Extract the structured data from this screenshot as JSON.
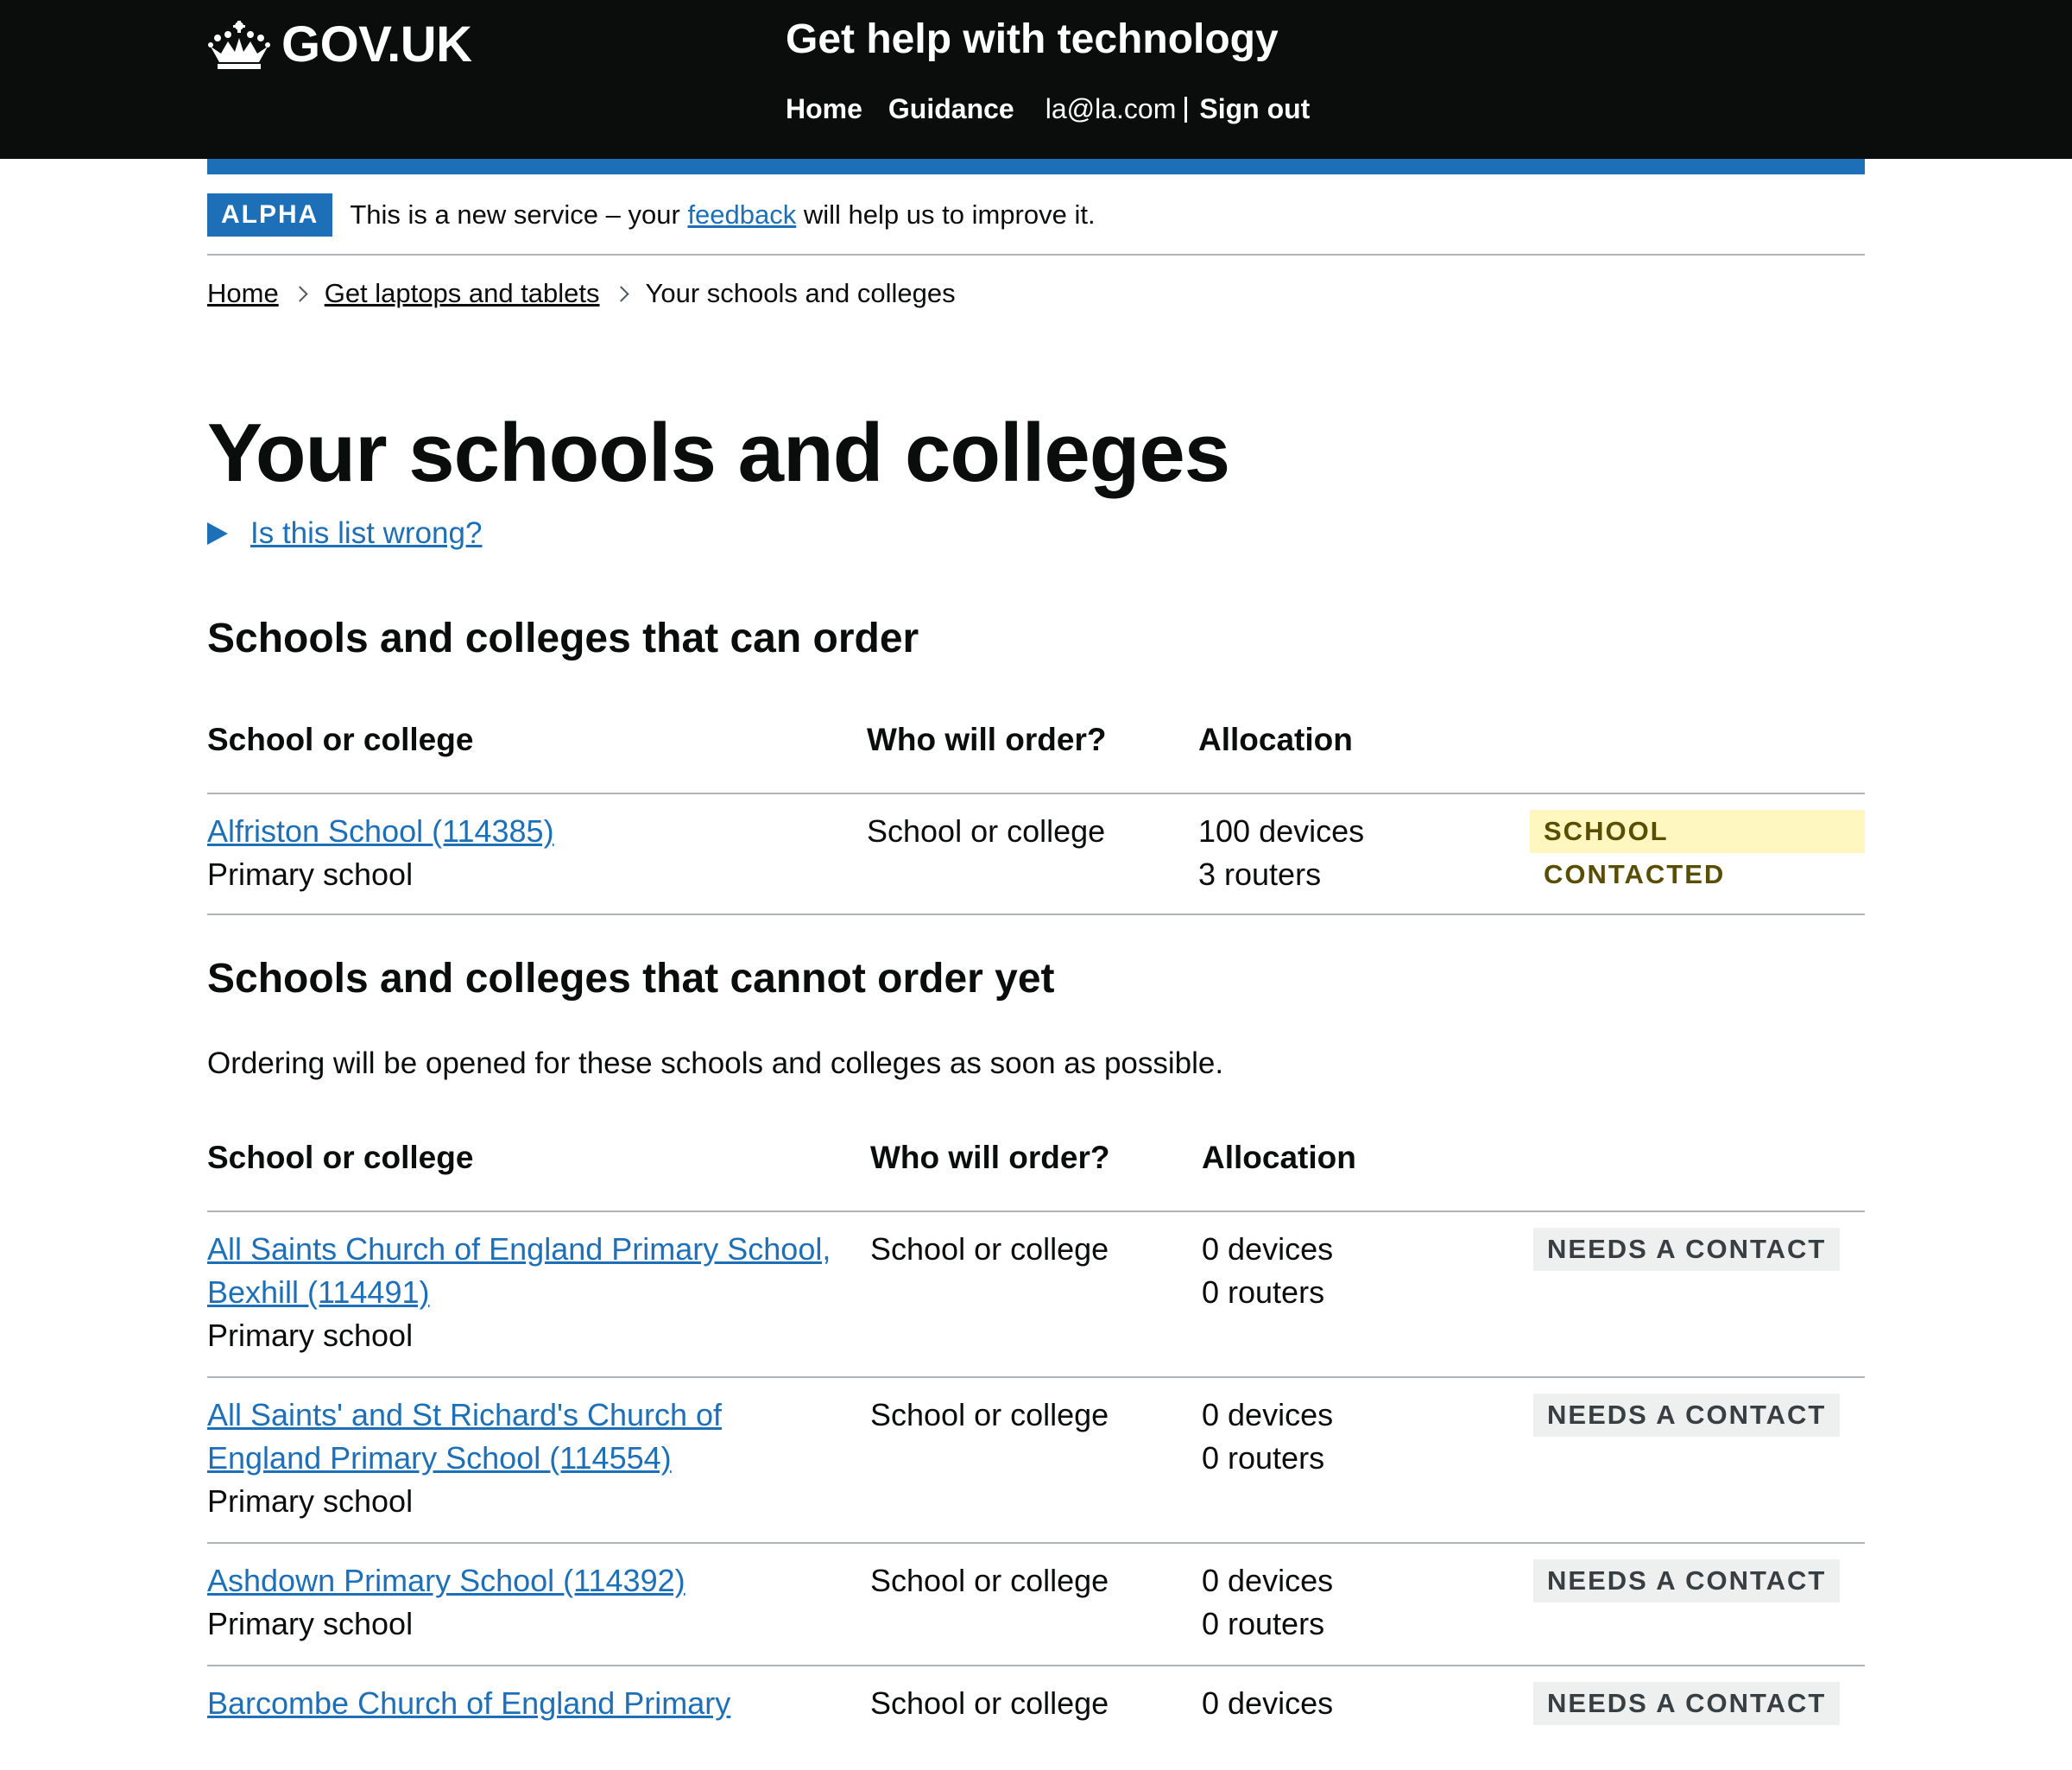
{
  "header": {
    "logo_text": "GOV.UK",
    "service_name": "Get help with technology",
    "nav": {
      "home": "Home",
      "guidance": "Guidance",
      "user_email": "la@la.com",
      "sign_out": "Sign out"
    }
  },
  "phase_banner": {
    "tag": "ALPHA",
    "text_before": "This is a new service – your ",
    "link": "feedback",
    "text_after": " will help us to improve it."
  },
  "breadcrumbs": [
    "Home",
    "Get laptops and tablets",
    "Your schools and colleges"
  ],
  "page_title": "Your schools and colleges",
  "details_summary": "Is this list wrong?",
  "can_order": {
    "heading": "Schools and colleges that can order",
    "columns": [
      "School or college",
      "Who will order?",
      "Allocation",
      ""
    ],
    "rows": [
      {
        "name": "Alfriston School (114385)",
        "type": "Primary school",
        "who": "School or college",
        "devices": "100 devices",
        "routers": "3 routers",
        "status": "SCHOOL CONTACTED"
      }
    ]
  },
  "cannot_order": {
    "heading": "Schools and colleges that cannot order yet",
    "lead": "Ordering will be opened for these schools and colleges as soon as possible.",
    "columns": [
      "School or college",
      "Who will order?",
      "Allocation",
      ""
    ],
    "rows": [
      {
        "name_line1": "All Saints Church of England Primary School,",
        "name_line2": "Bexhill (114491)",
        "type": "Primary school",
        "who": "School or college",
        "devices": "0 devices",
        "routers": "0 routers",
        "status": "NEEDS A CONTACT"
      },
      {
        "name_line1": "All Saints' and St Richard's Church of",
        "name_line2": "England Primary School (114554)",
        "type": "Primary school",
        "who": "School or college",
        "devices": "0 devices",
        "routers": "0 routers",
        "status": "NEEDS A CONTACT"
      },
      {
        "name_line1": "Ashdown Primary School (114392)",
        "name_line2": "",
        "type": "Primary school",
        "who": "School or college",
        "devices": "0 devices",
        "routers": "0 routers",
        "status": "NEEDS A CONTACT"
      },
      {
        "name_line1": "Barcombe Church of England Primary",
        "name_line2": "",
        "type": "",
        "who": "School or college",
        "devices": "0 devices",
        "routers": "",
        "status": "NEEDS A CONTACT"
      }
    ]
  }
}
